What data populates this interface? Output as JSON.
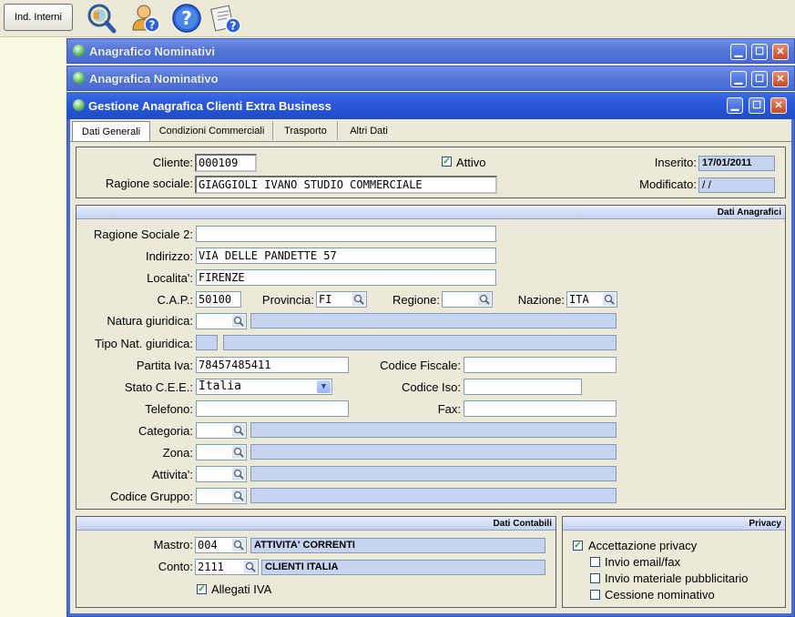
{
  "toolbar": {
    "ind_interni_label": "Ind. Interni",
    "icons": [
      "search-icon",
      "user-help-icon",
      "help-icon",
      "document-help-icon"
    ]
  },
  "windows": {
    "bg1_title": "Anagrafico Nominativi",
    "bg2_title": "Anagrafica Nominativo",
    "main_title": "Gestione Anagrafica Clienti Extra Business",
    "controls": {
      "minimize": "▁",
      "maximize": "☐",
      "close": "✕"
    }
  },
  "tabs": [
    "Dati Generali",
    "Condizioni Commerciali",
    "Trasporto",
    "Altri Dati"
  ],
  "header": {
    "cliente_label": "Cliente:",
    "cliente_value": "000109",
    "attivo_label": "Attivo",
    "attivo_checked": true,
    "ragione_sociale_label": "Ragione sociale:",
    "ragione_sociale_value": "GIAGGIOLI IVANO STUDIO COMMERCIALE",
    "inserito_label": "Inserito:",
    "inserito_value": "17/01/2011",
    "modificato_label": "Modificato:",
    "modificato_value": " / /"
  },
  "anagrafici": {
    "title": "Dati Anagrafici",
    "ragione_sociale2_label": "Ragione Sociale 2:",
    "ragione_sociale2_value": "",
    "indirizzo_label": "Indirizzo:",
    "indirizzo_value": "VIA DELLE PANDETTE 57",
    "localita_label": "Localita':",
    "localita_value": "FIRENZE",
    "cap_label": "C.A.P.:",
    "cap_value": "50100",
    "provincia_label": "Provincia:",
    "provincia_value": "FI",
    "regione_label": "Regione:",
    "regione_value": "",
    "nazione_label": "Nazione:",
    "nazione_value": "ITA",
    "natura_label": "Natura giuridica:",
    "tipo_nat_label": "Tipo Nat. giuridica:",
    "partita_iva_label": "Partita Iva:",
    "partita_iva_value": "78457485411",
    "codice_fiscale_label": "Codice Fiscale:",
    "codice_fiscale_value": "",
    "stato_cee_label": "Stato C.E.E.:",
    "stato_cee_value": "Italia",
    "codice_iso_label": "Codice Iso:",
    "codice_iso_value": "",
    "telefono_label": "Telefono:",
    "telefono_value": "",
    "fax_label": "Fax:",
    "fax_value": "",
    "categoria_label": "Categoria:",
    "zona_label": "Zona:",
    "attivita_label": "Attivita':",
    "codice_gruppo_label": "Codice Gruppo:"
  },
  "contabili": {
    "title": "Dati Contabili",
    "mastro_label": "Mastro:",
    "mastro_value": "004",
    "mastro_desc": "ATTIVITA' CORRENTI",
    "conto_label": "Conto:",
    "conto_value": "2111",
    "conto_desc": "CLIENTI ITALIA",
    "allegati_iva_label": "Allegati IVA",
    "allegati_iva_checked": true
  },
  "privacy": {
    "title": "Privacy",
    "items": [
      {
        "label": "Accettazione privacy",
        "checked": true
      },
      {
        "label": "Invio email/fax",
        "checked": false
      },
      {
        "label": "Invio materiale pubblicitario",
        "checked": false
      },
      {
        "label": "Cessione nominativo",
        "checked": false
      }
    ]
  },
  "colors": {
    "titlebar_active": "#2a58d8",
    "titlebar_inactive": "#5577d8",
    "panel_bg": "#ece9d8",
    "readonly_field": "#c7d4ef",
    "desktop": "#fbfae3"
  }
}
